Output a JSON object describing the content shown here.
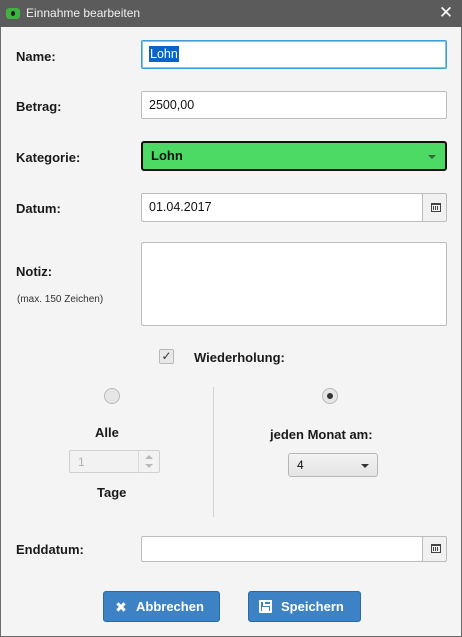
{
  "window": {
    "title": "Einnahme bearbeiten",
    "close_icon": "close-icon",
    "app_icon": "eye-icon"
  },
  "form": {
    "name_label": "Name:",
    "name_value": "Lohn",
    "amount_label": "Betrag:",
    "amount_value": "2500,00",
    "category_label": "Kategorie:",
    "category_value": "Lohn",
    "category_color": "#4cd964",
    "date_label": "Datum:",
    "date_value": "01.04.2017",
    "note_label": "Notiz:",
    "note_hint": "(max. 150 Zeichen)",
    "note_value": "",
    "repeat_checked": true,
    "repeat_label": "Wiederholung:",
    "every_label": "Alle",
    "every_value": "1",
    "days_label": "Tage",
    "monthly_label": "jeden Monat am:",
    "monthly_value": "4",
    "end_date_label": "Enddatum:",
    "end_date_value": "",
    "checkmark": "✓"
  },
  "buttons": {
    "cancel_label": "Abbrechen",
    "cancel_icon": "✖",
    "save_label": "Speichern",
    "accent_color": "#3d82c4"
  }
}
